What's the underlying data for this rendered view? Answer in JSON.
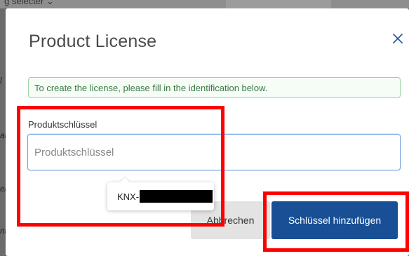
{
  "background": {
    "top_text": "g selecter ⌄",
    "edge_letters": [
      "l",
      "at",
      "e/",
      "nt"
    ]
  },
  "dialog": {
    "title": "Product License",
    "close_icon": "close-icon",
    "info_message": "To create the license, please fill in the identification below.",
    "field": {
      "label": "Produktschlüssel",
      "placeholder": "Produktschlüssel",
      "value": ""
    },
    "autocomplete": {
      "prefix": "KNX-"
    },
    "buttons": {
      "cancel_label": "Abbrechen",
      "add_label": "Schlüssel hinzufügen"
    }
  },
  "colors": {
    "primary": "#184f95",
    "highlight": "#ff0000",
    "info_border": "#9bd3a3",
    "info_text": "#3a7a45"
  }
}
